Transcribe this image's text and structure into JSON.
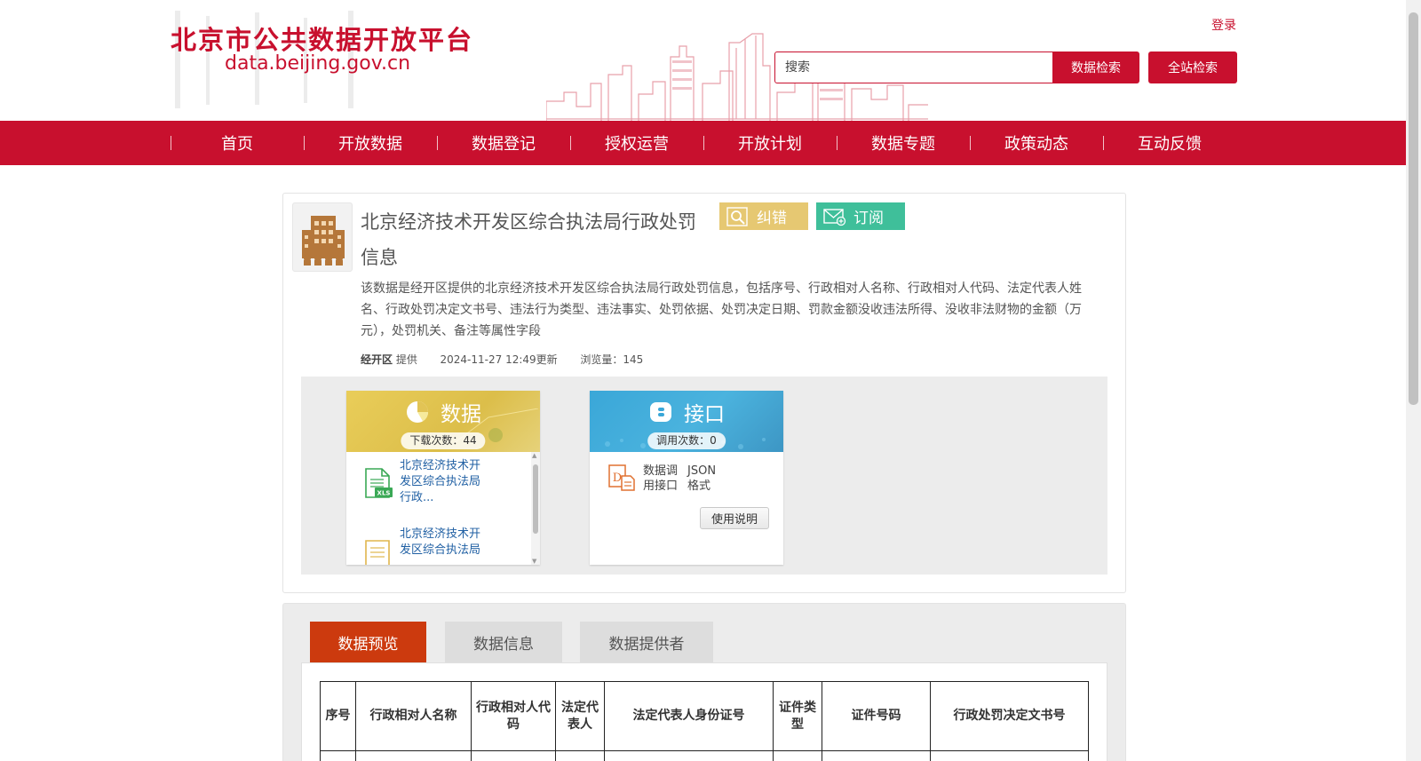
{
  "header": {
    "site_title": "北京市公共数据开放平台",
    "site_domain": "data.beijing.gov.cn",
    "login": "登录",
    "search_placeholder": "搜索",
    "data_search": "数据检索",
    "site_search": "全站检索"
  },
  "nav": {
    "items": [
      "首页",
      "开放数据",
      "数据登记",
      "授权运营",
      "开放计划",
      "数据专题",
      "政策动态",
      "互动反馈"
    ]
  },
  "dataset": {
    "icon": "building-icon",
    "title": "北京经济技术开发区综合执法局行政处罚信息",
    "correct_label": "纠错",
    "subscribe_label": "订阅",
    "description": "该数据是经开区提供的北京经济技术开发区综合执法局行政处罚信息，包括序号、行政相对人名称、行政相对人代码、法定代表人姓名、行政处罚决定文书号、违法行为类型、违法事实、处罚依据、处罚决定日期、罚款金额没收违法所得、没收非法财物的金额（万元），处罚机关、备注等属性字段",
    "provider": "经开区",
    "provider_suffix": "提供",
    "updated": "2024-11-27 12:49更新",
    "views": "浏览量：145"
  },
  "data_box": {
    "title": "数据",
    "count": "下载次数：44",
    "files": [
      {
        "name": "北京经济技术开发区综合执法局行政...",
        "icon": "xls-file-icon"
      },
      {
        "name": "北京经济技术开发区综合执法局",
        "icon": "csv-file-icon"
      }
    ]
  },
  "api_box": {
    "title": "接口",
    "count": "调用次数：0",
    "api_name": "数据调用接口",
    "format": "JSON格式",
    "usage_button": "使用说明"
  },
  "tabs": {
    "items": [
      "数据预览",
      "数据信息",
      "数据提供者"
    ],
    "active": 0
  },
  "table": {
    "headers": [
      "序号",
      "行政相对人名称",
      "行政相对人代码",
      "法定代表人",
      "法定代表人身份证号",
      "证件类型",
      "证件号码",
      "行政处罚决定文书号"
    ]
  },
  "colors": {
    "brand_red": "#c8102e",
    "correct_yellow": "#e6c872",
    "subscribe_green": "#3fbf9a",
    "active_tab": "#cc3a0e",
    "link_blue": "#1f5fa3"
  }
}
